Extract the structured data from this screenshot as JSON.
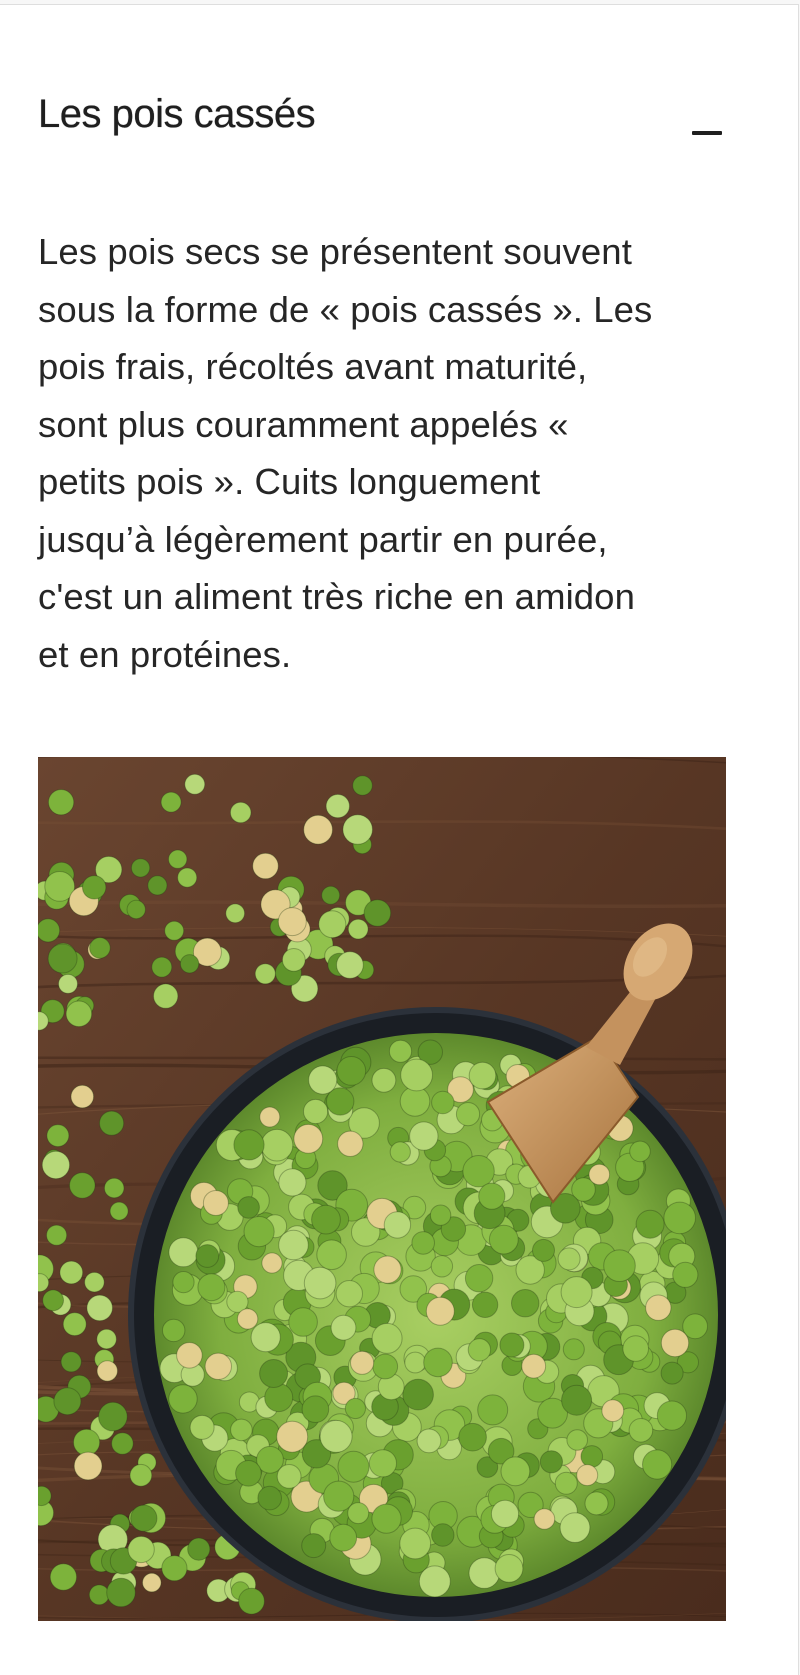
{
  "section": {
    "title": "Les pois cassés",
    "body": "Les pois secs se présentent souvent\nsous la forme de « pois cassés ». Les\npois frais, récoltés avant maturité,\nsont plus couramment appelés «\npetits pois ». Cuits longuement\njusqu’à légèrement partir en purée,\nc'est un aliment très riche en amidon\net en protéines.",
    "toggle_icon": "minus-icon",
    "image_subject": "split-peas-bowl-photo"
  },
  "colors": {
    "background": "#ffffff",
    "text": "#262626",
    "wood": "#5a3a28",
    "pea_green": "#8fbf4a",
    "bowl": "#1c2026",
    "scoop": "#c99866"
  }
}
